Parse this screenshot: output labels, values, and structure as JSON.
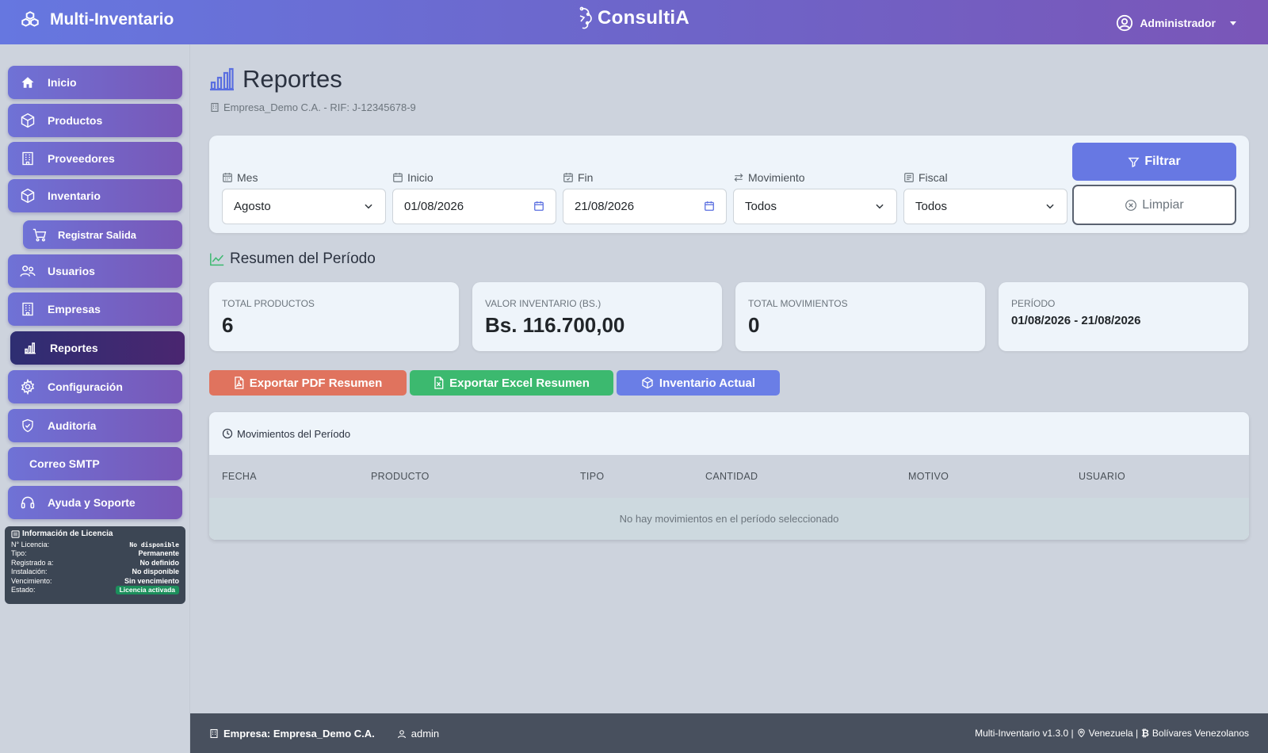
{
  "topbar": {
    "brand": "Multi-Inventario",
    "center_logo": "ConsultiA",
    "user": "Administrador"
  },
  "sidebar": {
    "items": [
      {
        "label": "Inicio",
        "icon": "home-icon"
      },
      {
        "label": "Productos",
        "icon": "box-icon"
      },
      {
        "label": "Proveedores",
        "icon": "building-icon"
      },
      {
        "label": "Inventario",
        "icon": "box-icon"
      },
      {
        "label": "Registrar Salida",
        "icon": "cart-icon"
      },
      {
        "label": "Usuarios",
        "icon": "users-icon"
      },
      {
        "label": "Empresas",
        "icon": "building-icon"
      },
      {
        "label": "Reportes",
        "icon": "bar-chart-icon"
      },
      {
        "label": "Configuración",
        "icon": "gear-icon"
      },
      {
        "label": "Auditoría",
        "icon": "shield-icon"
      },
      {
        "label": "Correo SMTP",
        "icon": ""
      },
      {
        "label": "Ayuda y Soporte",
        "icon": "headset-icon"
      }
    ],
    "active": "Reportes"
  },
  "license": {
    "title": "Información de Licencia",
    "rows": [
      {
        "label": "N° Licencia:",
        "value": "No disponible"
      },
      {
        "label": "Tipo:",
        "value": "Permanente"
      },
      {
        "label": "Registrado a:",
        "value": "No definido"
      },
      {
        "label": "Instalación:",
        "value": "No disponible"
      },
      {
        "label": "Vencimiento:",
        "value": "Sin vencimiento"
      },
      {
        "label": "Estado:",
        "value": "Licencia activada"
      }
    ]
  },
  "page": {
    "title": "Reportes",
    "company_line": "Empresa_Demo C.A. - RIF: J-12345678-9"
  },
  "filters": {
    "mes": {
      "label": "Mes",
      "value": "Agosto"
    },
    "inicio": {
      "label": "Inicio",
      "value": "01/08/2026"
    },
    "fin": {
      "label": "Fin",
      "value": "21/08/2026"
    },
    "movimiento": {
      "label": "Movimiento",
      "value": "Todos"
    },
    "fiscal": {
      "label": "Fiscal",
      "value": "Todos"
    },
    "filtrar": "Filtrar",
    "limpiar": "Limpiar"
  },
  "summary": {
    "title": "Resumen del Período",
    "cards": [
      {
        "label": "TOTAL PRODUCTOS",
        "value": "6"
      },
      {
        "label": "VALOR INVENTARIO (BS.)",
        "value": "Bs. 116.700,00"
      },
      {
        "label": "TOTAL MOVIMIENTOS",
        "value": "0"
      },
      {
        "label": "PERÍODO",
        "value": "01/08/2026 - 21/08/2026"
      }
    ]
  },
  "exports": {
    "pdf": "Exportar PDF Resumen",
    "excel": "Exportar Excel Resumen",
    "inventario": "Inventario Actual",
    "colors": {
      "pdf": "#e0735e",
      "excel": "#3cb96f",
      "inventario": "#6a7ee6"
    }
  },
  "movements": {
    "title": "Movimientos del Período",
    "columns": [
      "FECHA",
      "PRODUCTO",
      "TIPO",
      "CANTIDAD",
      "MOTIVO",
      "USUARIO"
    ],
    "empty": "No hay movimientos en el período seleccionado"
  },
  "footer": {
    "company": "Empresa: Empresa_Demo C.A.",
    "user": "admin",
    "version": "Multi-Inventario v1.3.0 |",
    "country": "Venezuela |",
    "currency": "Bolívares Venezolanos"
  }
}
